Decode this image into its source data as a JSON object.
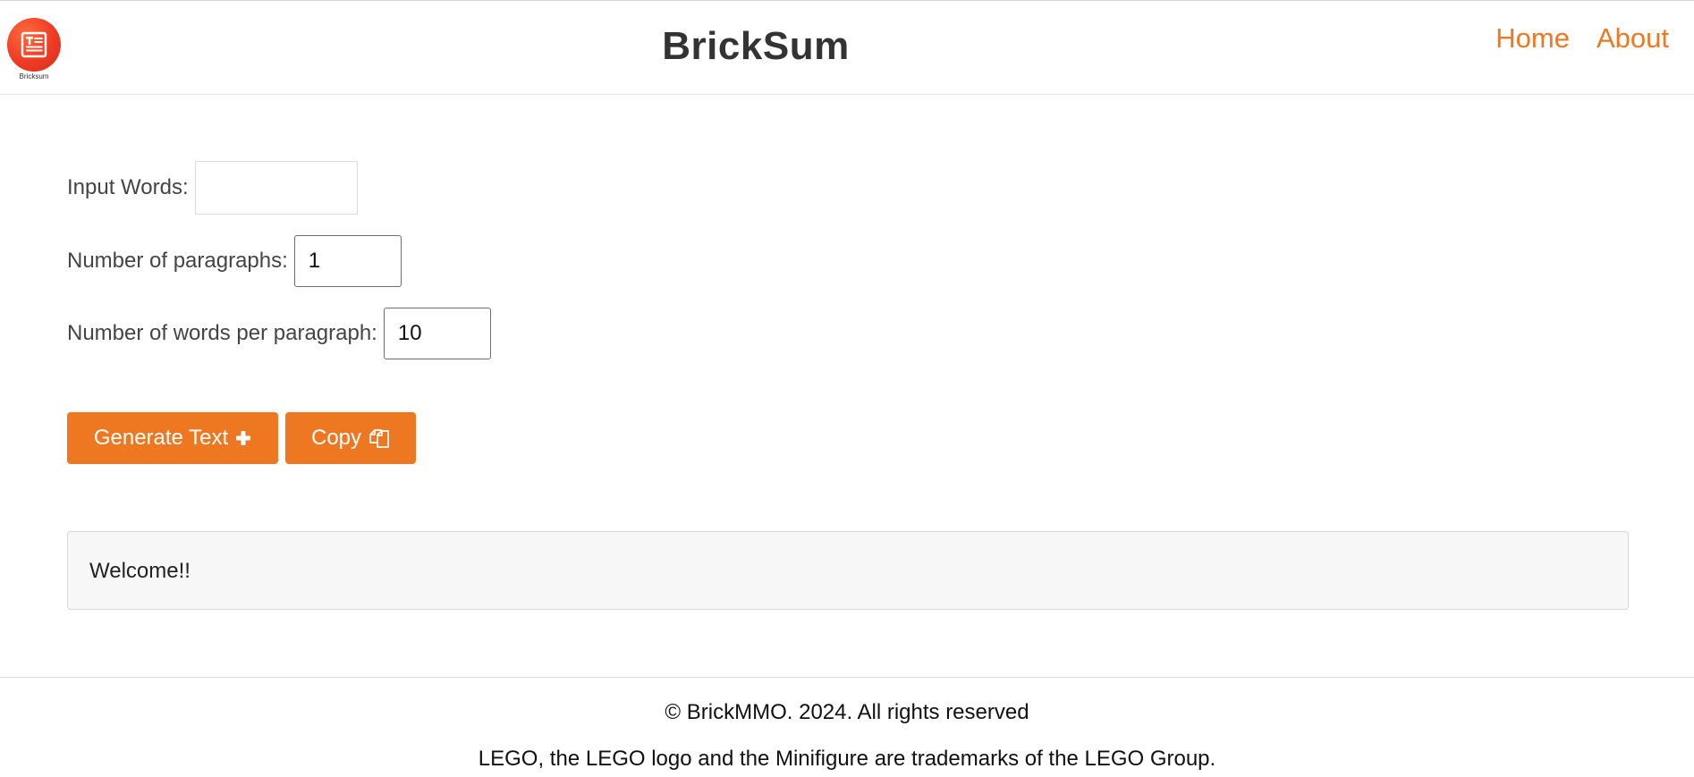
{
  "header": {
    "logo_caption": "Bricksum",
    "title": "BrickSum",
    "nav": [
      {
        "label": "Home"
      },
      {
        "label": "About"
      }
    ]
  },
  "form": {
    "input_words_label": "Input Words:",
    "input_words_value": "",
    "paragraphs_label": "Number of paragraphs:",
    "paragraphs_value": "1",
    "words_per_paragraph_label": "Number of words per paragraph:",
    "words_per_paragraph_value": "10"
  },
  "actions": {
    "generate_label": "Generate Text",
    "generate_icon": "plus-icon",
    "copy_label": "Copy",
    "copy_icon": "copy-icon"
  },
  "output": {
    "text": "Welcome!!"
  },
  "footer": {
    "copyright": "© BrickMMO. 2024. All rights reserved",
    "trademark": "LEGO, the LEGO logo and the Minifigure are trademarks of the LEGO Group."
  },
  "colors": {
    "accent": "#ee7722",
    "logo": "#ee3b24"
  }
}
